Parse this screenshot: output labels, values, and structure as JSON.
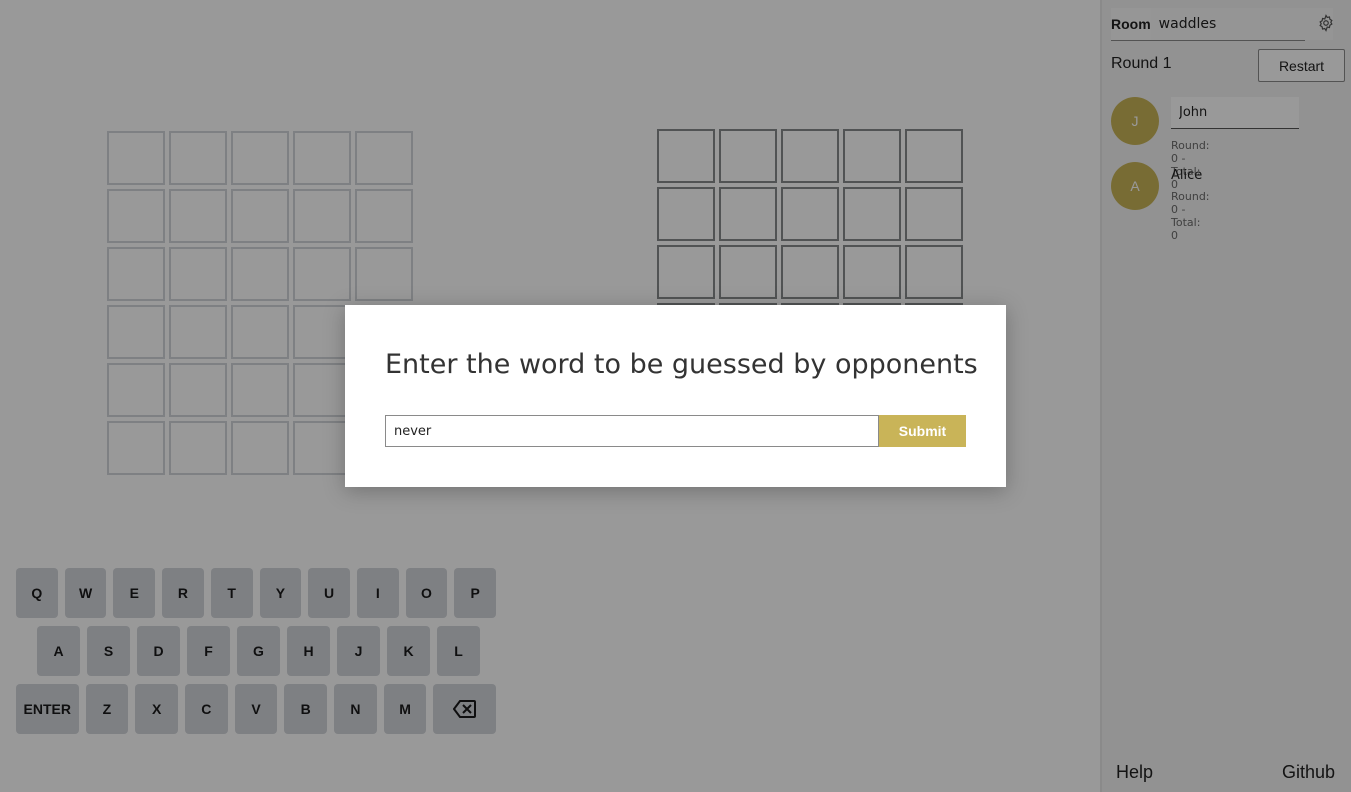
{
  "game": {
    "board_left": {
      "rows": 6,
      "cols": 5
    },
    "board_right": {
      "rows": 6,
      "cols": 5
    },
    "keyboard": {
      "row1": [
        "Q",
        "W",
        "E",
        "R",
        "T",
        "Y",
        "U",
        "I",
        "O",
        "P"
      ],
      "row2": [
        "A",
        "S",
        "D",
        "F",
        "G",
        "H",
        "J",
        "K",
        "L"
      ],
      "row3_enter": "ENTER",
      "row3": [
        "Z",
        "X",
        "C",
        "V",
        "B",
        "N",
        "M"
      ],
      "backspace_icon": "backspace-icon"
    }
  },
  "sidebar": {
    "room_label": "Room",
    "room_value": "waddles",
    "settings_icon": "gear-icon",
    "round_label": "Round 1",
    "restart_label": "Restart",
    "players": [
      {
        "initial": "J",
        "name": "John",
        "score": "Round: 0 - Total: 0"
      },
      {
        "initial": "A",
        "name": "Alice",
        "score": "Round: 0 - Total: 0"
      }
    ],
    "help_label": "Help",
    "github_label": "Github"
  },
  "modal": {
    "title": "Enter the word to be guessed by opponents",
    "word_value": "never",
    "submit_label": "Submit"
  },
  "colors": {
    "accent": "#c9b458",
    "overlay": "rgba(0,0,0,0.4)"
  }
}
